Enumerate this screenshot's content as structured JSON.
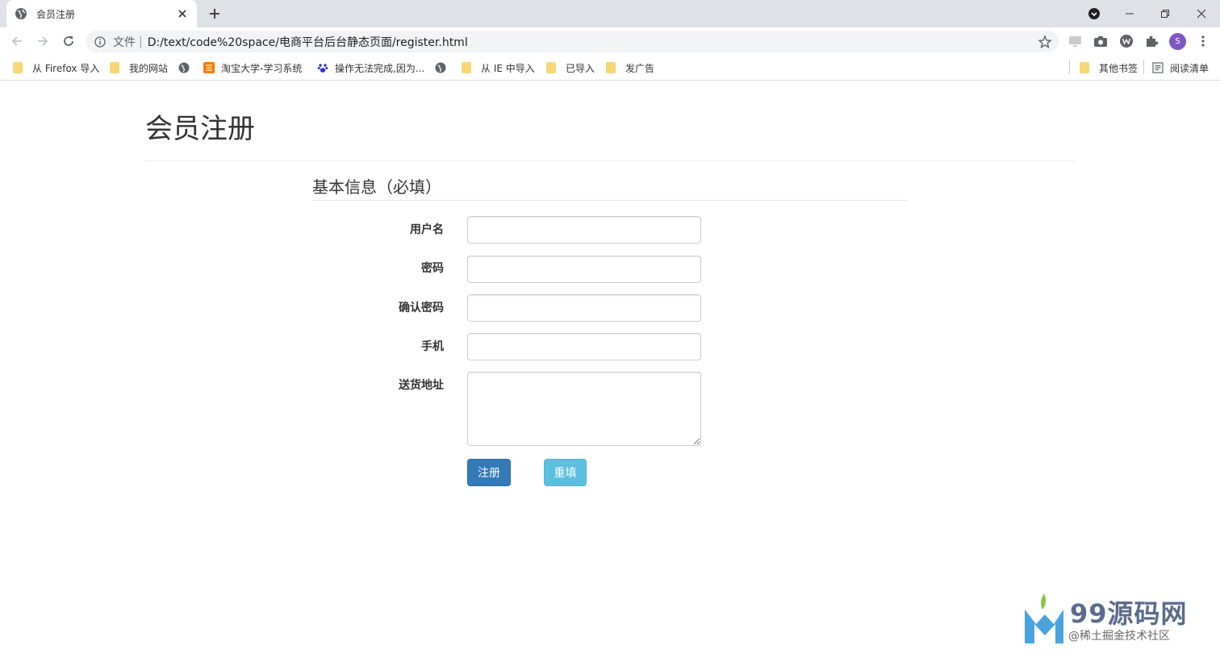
{
  "browser": {
    "tab_title": "会员注册",
    "new_tab_symbol": "+",
    "address": {
      "security_label": "文件",
      "separator": "|",
      "url": "D:/text/code%20space/电商平台后台静态页面/register.html"
    },
    "profile_initial": "S",
    "bookmarks": [
      {
        "label": "从 Firefox 导入",
        "icon": "folder-icon"
      },
      {
        "label": "我的网站",
        "icon": "folder-icon"
      },
      {
        "label": "",
        "icon": "globe-icon"
      },
      {
        "label": "淘宝大学-学习系统",
        "icon": "taobao-icon"
      },
      {
        "label": "操作无法完成,因为...",
        "icon": "baidu-paw-icon"
      },
      {
        "label": "",
        "icon": "globe-icon"
      },
      {
        "label": "从 IE 中导入",
        "icon": "folder-icon"
      },
      {
        "label": "已导入",
        "icon": "folder-icon"
      },
      {
        "label": "发广告",
        "icon": "folder-icon"
      }
    ],
    "other_bookmarks": "其他书签",
    "reading_list": "阅读清单"
  },
  "page": {
    "title": "会员注册",
    "section_title": "基本信息（必填）",
    "fields": [
      {
        "label": "用户名",
        "value": "",
        "type": "text"
      },
      {
        "label": "密码",
        "value": "",
        "type": "password"
      },
      {
        "label": "确认密码",
        "value": "",
        "type": "password"
      },
      {
        "label": "手机",
        "value": "",
        "type": "text"
      },
      {
        "label": "送货地址",
        "value": "",
        "type": "textarea"
      }
    ],
    "submit_label": "注册",
    "reset_label": "重填"
  },
  "watermark": {
    "brand": "99源码网",
    "sub": "@稀土掘金技术社区"
  },
  "colors": {
    "primary": "#337ab7",
    "info": "#5bc0de",
    "chrome_bg": "#dee1e6",
    "omnibox_bg": "#f1f3f4"
  }
}
